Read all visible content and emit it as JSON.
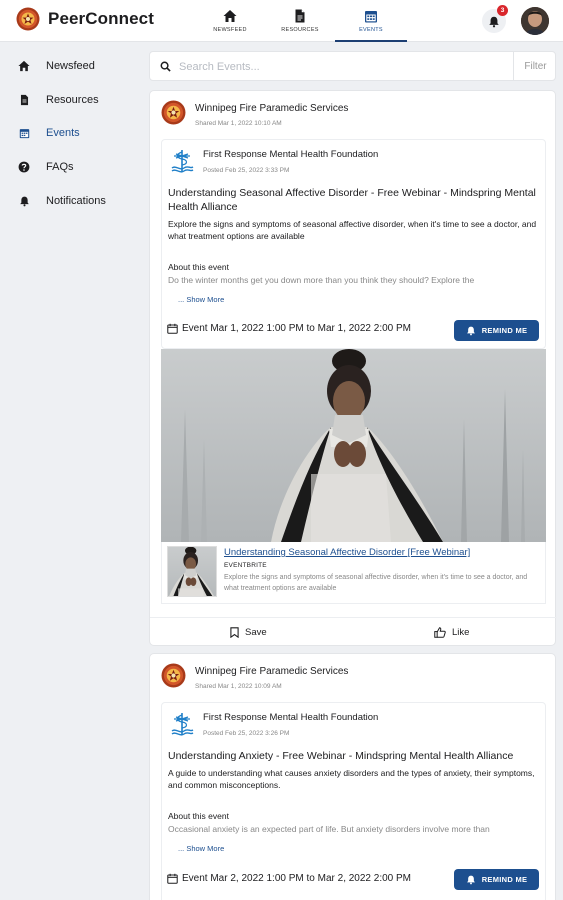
{
  "app": {
    "name": "PeerConnect",
    "notification_count": "3"
  },
  "nav_tabs": [
    {
      "label": "NEWSFEED",
      "icon": "home-icon"
    },
    {
      "label": "RESOURCES",
      "icon": "document-icon"
    },
    {
      "label": "EVENTS",
      "icon": "calendar-icon",
      "active": true
    }
  ],
  "sidebar": {
    "items": [
      {
        "label": "Newsfeed",
        "icon": "home-icon"
      },
      {
        "label": "Resources",
        "icon": "document-icon"
      },
      {
        "label": "Events",
        "icon": "calendar-icon",
        "active": true
      },
      {
        "label": "FAQs",
        "icon": "question-icon"
      },
      {
        "label": "Notifications",
        "icon": "bell-icon"
      }
    ]
  },
  "search": {
    "placeholder": "Search Events...",
    "filter_label": "Filter"
  },
  "colors": {
    "accent": "#1d4f8f",
    "badge": "#d9262c",
    "background": "#eef0f3"
  },
  "posts": [
    {
      "author": "Winnipeg Fire Paramedic Services",
      "shared": "Shared Mar 1, 2022 10:10 AM",
      "org_name": "First Response Mental Health Foundation",
      "org_posted": "Posted Feb 25, 2022 3:33 PM",
      "title": "Understanding Seasonal Affective Disorder - Free Webinar - Mindspring Mental Health Alliance",
      "description": "Explore the signs and symptoms of seasonal affective disorder, when it's time to see a doctor, and what treatment options are available",
      "about_label": "About this event",
      "about_text": "Do the winter months get you down more than you think they should? Explore the",
      "show_more": "... Show More",
      "event_date": "Event Mar 1, 2022 1:00 PM to Mar 1, 2022 2:00 PM",
      "remind_label": "REMIND ME",
      "link_title": "Understanding Seasonal Affective Disorder [Free Webinar]",
      "link_source": "EVENTBRITE",
      "link_desc": "Explore the signs and symptoms of seasonal affective disorder, when it's time to see a doctor, and what treatment options are available",
      "save_label": "Save",
      "like_label": "Like"
    },
    {
      "author": "Winnipeg Fire Paramedic Services",
      "shared": "Shared Mar 1, 2022 10:09 AM",
      "org_name": "First Response Mental Health Foundation",
      "org_posted": "Posted Feb 25, 2022 3:26 PM",
      "title": "Understanding Anxiety - Free Webinar - Mindspring Mental Health Alliance",
      "description": "A guide to understanding what causes anxiety disorders and the types of anxiety, their symptoms, and common misconceptions.",
      "about_label": "About this event",
      "about_text": "Occasional anxiety is an expected part of life. But anxiety disorders involve more than",
      "show_more": "... Show More",
      "event_date": "Event Mar 2, 2022 1:00 PM to Mar 2, 2022 2:00 PM",
      "remind_label": "REMIND ME"
    }
  ]
}
